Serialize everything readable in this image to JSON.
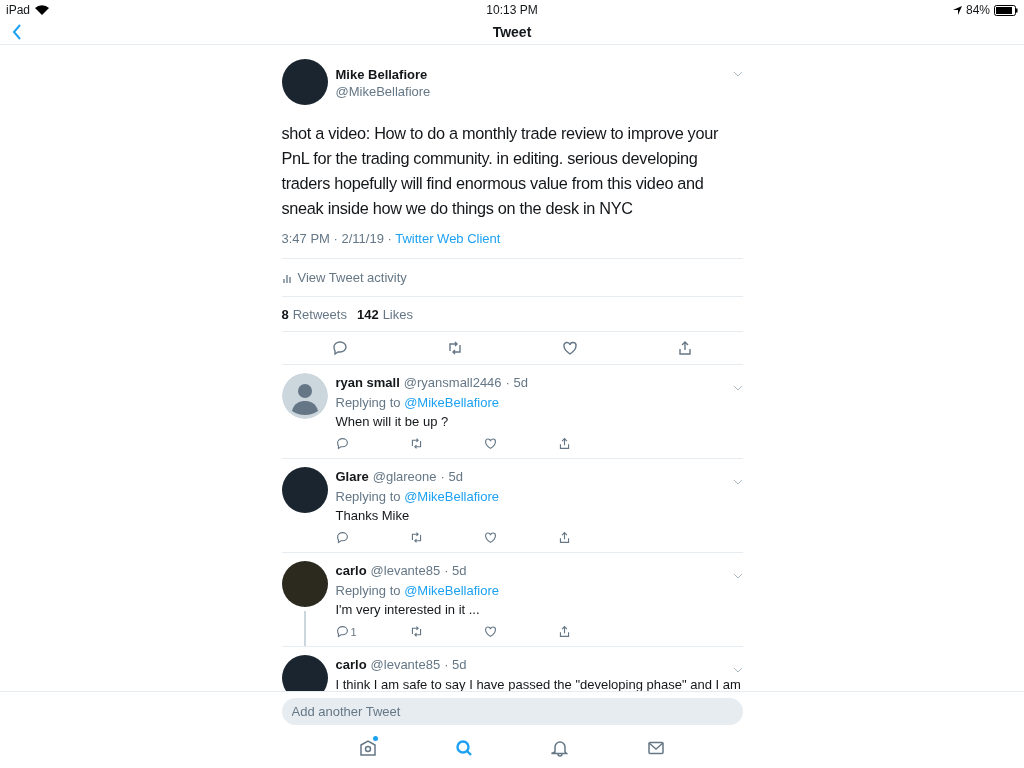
{
  "status_bar": {
    "device": "iPad",
    "time": "10:13 PM",
    "battery": "84%"
  },
  "nav": {
    "title": "Tweet"
  },
  "tweet": {
    "name": "Mike Bellafiore",
    "handle": "@MikeBellafiore",
    "text": "shot a video: How to do a monthly trade review to improve your PnL for the trading community.  in editing.  serious developing traders hopefully will find enormous value from this video and sneak inside how we do things on the desk in NYC",
    "time": "3:47 PM · 2/11/19 · ",
    "source": "Twitter Web Client",
    "activity": "View Tweet activity",
    "retweets": "8",
    "retweets_label": "Retweets",
    "likes": "142",
    "likes_label": "Likes"
  },
  "replies": [
    {
      "name": "ryan small",
      "handle": "@ryansmall2446",
      "age": "· 5d",
      "has_photo": false,
      "replying_label": "Replying to",
      "replying_to": "@MikeBellafiore",
      "text": "When will it be up ?",
      "threaded": false
    },
    {
      "name": "Glare",
      "handle": "@glareone",
      "age": "· 5d",
      "has_photo": true,
      "replying_label": "Replying to",
      "replying_to": "@MikeBellafiore",
      "text": "Thanks Mike",
      "threaded": false
    },
    {
      "name": "carlo",
      "handle": "@levante85",
      "age": "· 5d",
      "has_photo": true,
      "replying_label": "Replying to",
      "replying_to": "@MikeBellafiore",
      "text": "I'm very interested in it ...",
      "reply_count": "1",
      "threaded": true
    },
    {
      "name": "carlo",
      "handle": "@levante85",
      "age": "· 5d",
      "has_photo": true,
      "text": "I think I am safe to say I have passed the \"developing phase\" and I am",
      "threaded": false
    }
  ],
  "compose": {
    "placeholder": "Add another Tweet"
  },
  "tabs": [
    {
      "kind": "home",
      "selected": false,
      "has_new": true
    },
    {
      "kind": "search",
      "selected": true,
      "has_new": false
    },
    {
      "kind": "notifications",
      "selected": false,
      "has_new": false
    },
    {
      "kind": "messages",
      "selected": false,
      "has_new": false
    }
  ]
}
